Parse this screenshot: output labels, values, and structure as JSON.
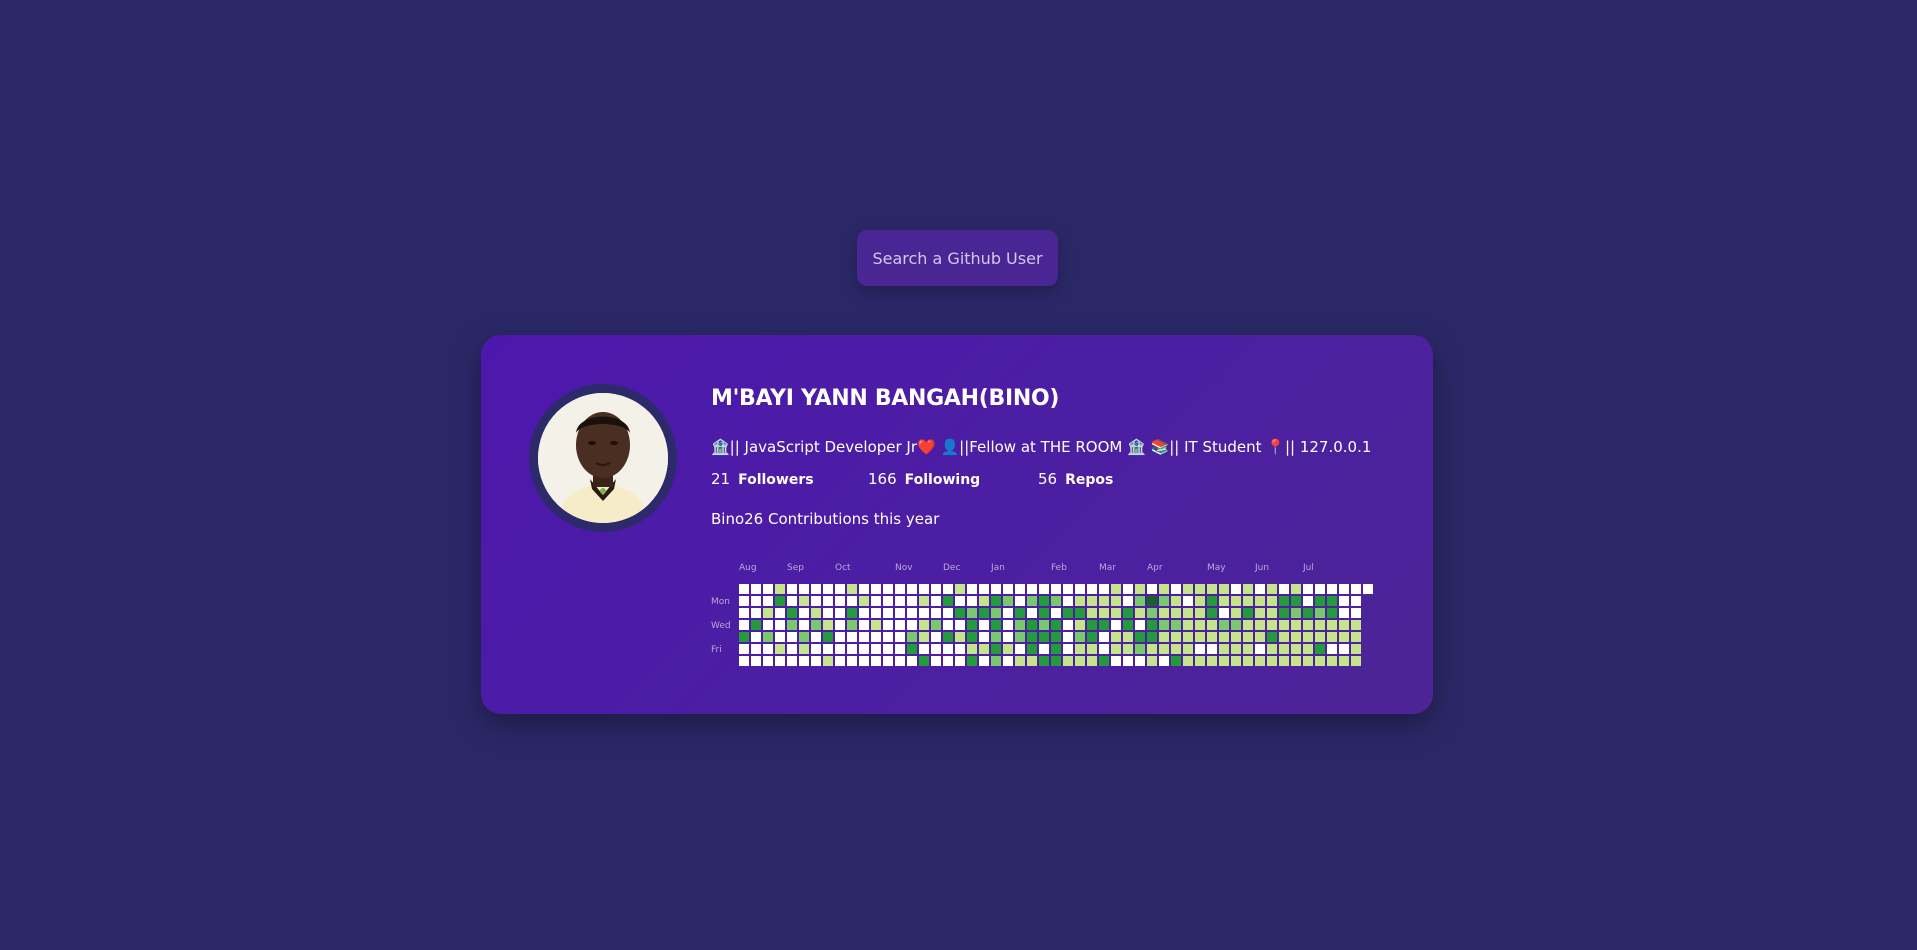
{
  "search": {
    "placeholder": "Search a Github User"
  },
  "profile": {
    "name": "M'BAYI YANN BANGAH(BINO)",
    "bio": "🏦|| JavaScript Developer Jr❤️ 👤||Fellow at THE ROOM 🏦 📚|| IT Student 📍|| 127.0.0.1",
    "followers_count": "21",
    "followers_label": "Followers",
    "following_count": "166",
    "following_label": "Following",
    "repos_count": "56",
    "repos_label": "Repos",
    "contributions_title": "Bino26 Contributions this year"
  },
  "contributions": {
    "months": [
      {
        "label": "Aug",
        "week": 0
      },
      {
        "label": "Sep",
        "week": 4
      },
      {
        "label": "Oct",
        "week": 8
      },
      {
        "label": "Nov",
        "week": 13
      },
      {
        "label": "Dec",
        "week": 17
      },
      {
        "label": "Jan",
        "week": 21
      },
      {
        "label": "Feb",
        "week": 26
      },
      {
        "label": "Mar",
        "week": 30
      },
      {
        "label": "Apr",
        "week": 34
      },
      {
        "label": "May",
        "week": 39
      },
      {
        "label": "Jun",
        "week": 43
      },
      {
        "label": "Jul",
        "week": 47
      }
    ],
    "day_labels": [
      {
        "label": "Mon",
        "row": 1
      },
      {
        "label": "Wed",
        "row": 3
      },
      {
        "label": "Fri",
        "row": 5
      }
    ],
    "colors": [
      "#ffffff",
      "#c6e48b",
      "#7bc96f",
      "#239a3b",
      "#196127"
    ],
    "weeks": 53,
    "grid": [
      "0001000001000000001000000000000101010111101010100000000",
      "0003010000100001030013202320111102421013111113303300",
      "0010301003000000003232030303311131211113013113232300",
      "0300202102010001200303023230133030322111221111111111",
      "3020020300000021031302023330230113311111111131111111",
      "0001010000000030000113103030110112111100111011113001",
      "0000000100000003000302011331113000103111111111111111"
    ]
  }
}
